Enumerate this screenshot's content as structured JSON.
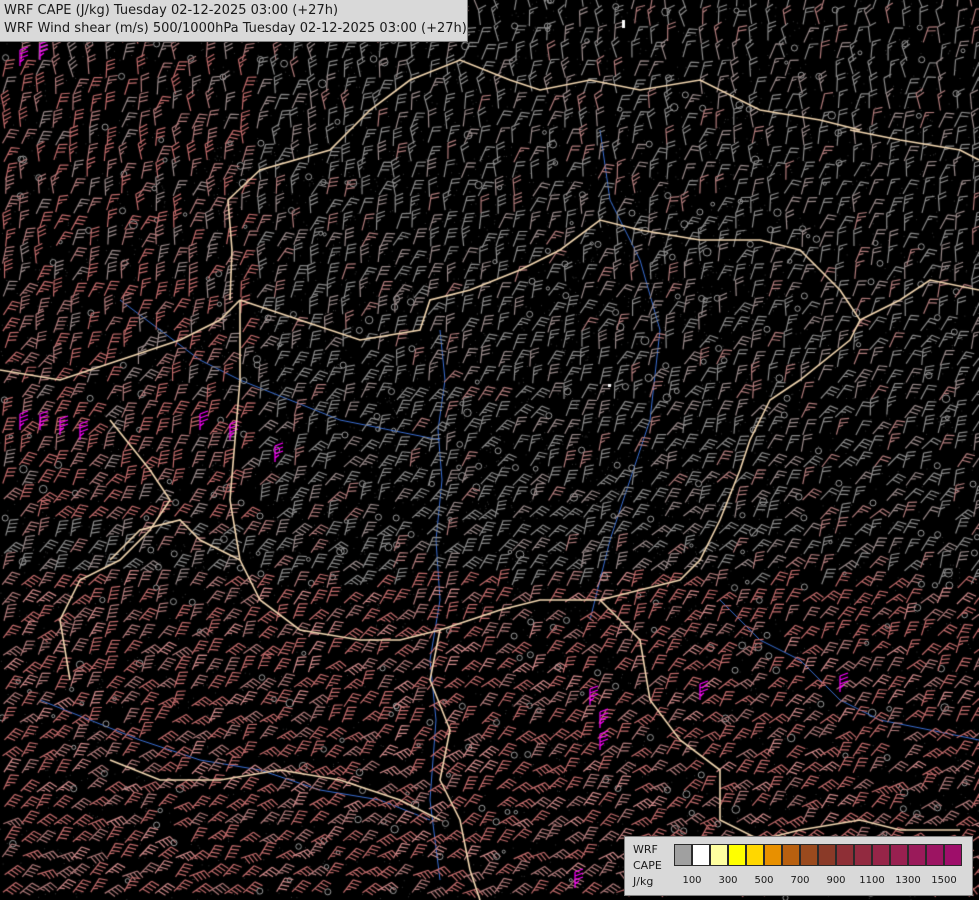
{
  "header": {
    "line1": "WRF CAPE (J/kg) Tuesday 02-12-2025 03:00 (+27h)",
    "line2": "WRF Wind shear (m/s) 500/1000hPa Tuesday 02-12-2025 03:00 (+27h)"
  },
  "legend": {
    "label_line1": "WRF",
    "label_line2": "CAPE",
    "label_line3": "J/kg",
    "swatch_colors": [
      "#a0a0a0",
      "#ffffff",
      "#ffffa0",
      "#ffff00",
      "#ffd700",
      "#e89000",
      "#b86010",
      "#9a4a1e",
      "#8a3a28",
      "#8e2f36",
      "#922a40",
      "#962548",
      "#982050",
      "#9a1a5a",
      "#9c1462",
      "#9e0e6a"
    ],
    "tick_labels": [
      "100",
      "300",
      "500",
      "700",
      "900",
      "1100",
      "1300",
      "1500"
    ]
  },
  "map": {
    "background_color": "#000000",
    "country_border_color": "#f2d6b0",
    "river_color": "#3b6fd4",
    "barb_colors": [
      "#8a8a8a",
      "#9a8a8a",
      "#b07a7a",
      "#c06a6a",
      "#d08a8a",
      "#e060e0",
      "#ff00ff"
    ],
    "contour_color": "#bdbdbd",
    "icons": [
      "wind-barb-icon",
      "calm-circle-icon"
    ]
  }
}
